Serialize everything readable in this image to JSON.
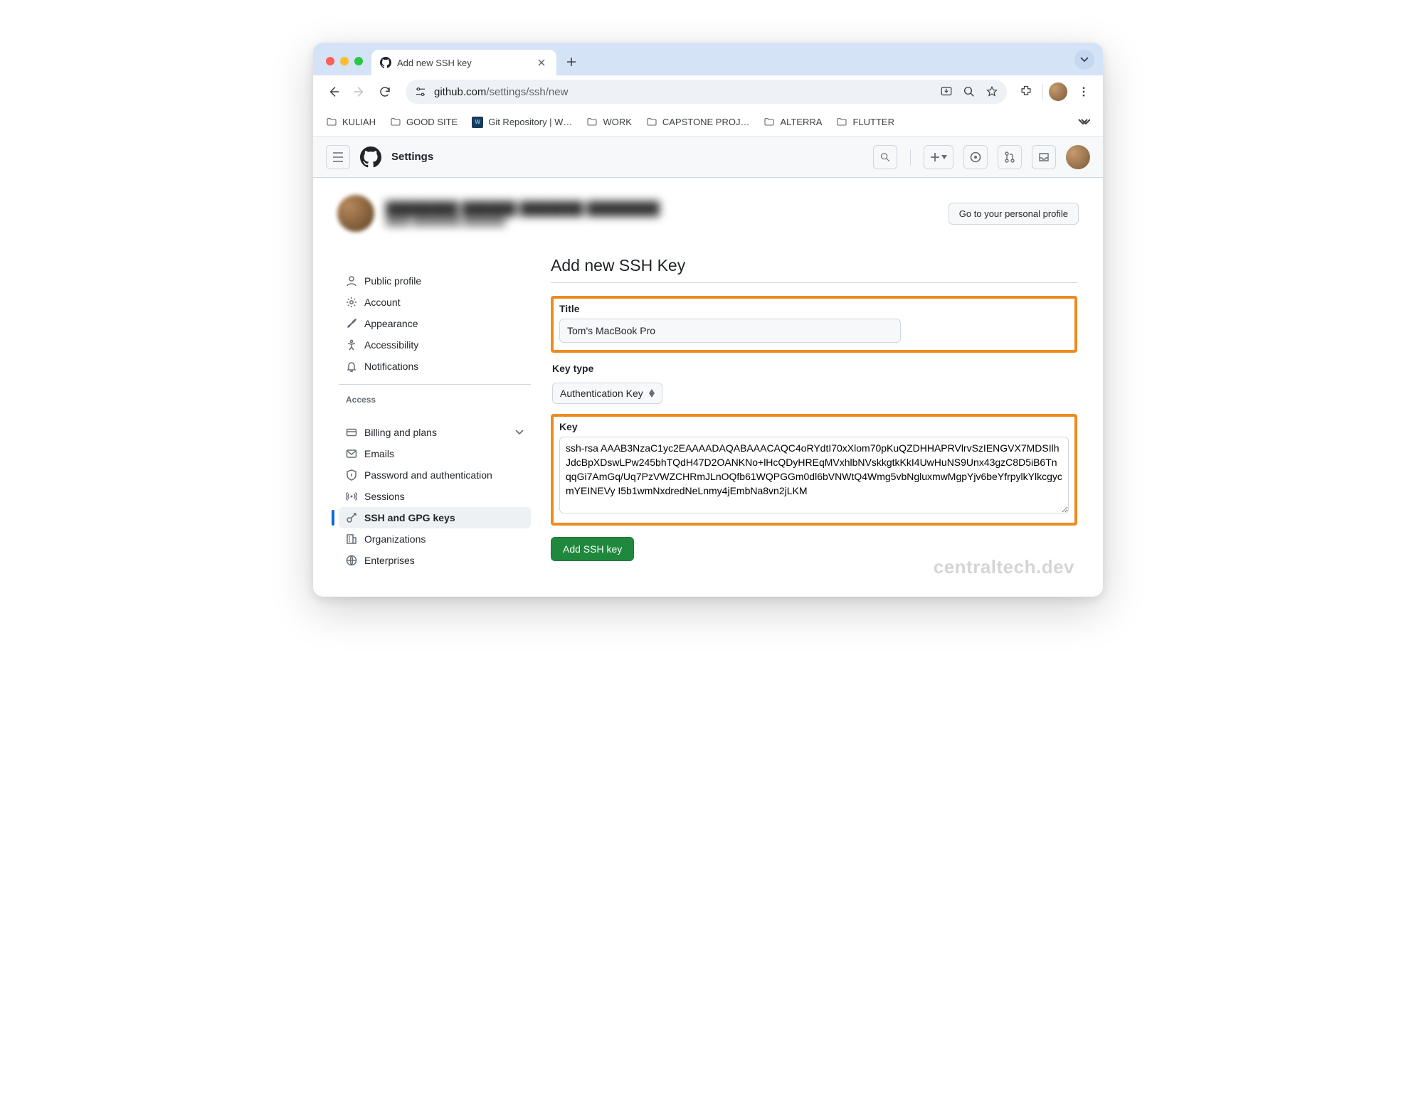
{
  "browser": {
    "tab_title": "Add new SSH key",
    "url_domain": "github.com",
    "url_path": "/settings/ssh/new",
    "bookmarks": [
      {
        "type": "folder",
        "label": "KULIAH"
      },
      {
        "type": "folder",
        "label": "GOOD SITE"
      },
      {
        "type": "site",
        "label": "Git Repository | W…"
      },
      {
        "type": "folder",
        "label": "WORK"
      },
      {
        "type": "folder",
        "label": "CAPSTONE PROJ…"
      },
      {
        "type": "folder",
        "label": "ALTERRA"
      },
      {
        "type": "folder",
        "label": "FLUTTER"
      }
    ]
  },
  "gh_header": {
    "page": "Settings"
  },
  "profile": {
    "go_profile_btn": "Go to your personal profile"
  },
  "sidebar": {
    "items_top": [
      {
        "icon": "person",
        "label": "Public profile"
      },
      {
        "icon": "gear",
        "label": "Account"
      },
      {
        "icon": "brush",
        "label": "Appearance"
      },
      {
        "icon": "accessibility",
        "label": "Accessibility"
      },
      {
        "icon": "bell",
        "label": "Notifications"
      }
    ],
    "access_heading": "Access",
    "items_access": [
      {
        "icon": "card",
        "label": "Billing and plans",
        "expandable": true
      },
      {
        "icon": "mail",
        "label": "Emails"
      },
      {
        "icon": "shield",
        "label": "Password and authentication"
      },
      {
        "icon": "broadcast",
        "label": "Sessions"
      },
      {
        "icon": "key",
        "label": "SSH and GPG keys",
        "active": true
      },
      {
        "icon": "org",
        "label": "Organizations"
      },
      {
        "icon": "globe",
        "label": "Enterprises"
      }
    ]
  },
  "form": {
    "heading": "Add new SSH Key",
    "title_label": "Title",
    "title_value": "Tom's MacBook Pro",
    "keytype_label": "Key type",
    "keytype_value": "Authentication Key",
    "key_label": "Key",
    "key_value": "ssh-rsa AAAB3NzaC1yc2EAAAADAQABAAACAQC4oRYdtI70xXlom70pKuQZDHHAPRVlrvSzIENGVX7MDSIlhJdcBpXDswLPw245bhTQdH47D2OANKNo+lHcQDyHREqMVxhlbNVskkgtkKkI4UwHuNS9Unx43gzC8D5iB6TnqqGi7AmGq/Uq7PzVWZCHRmJLnOQfb61WQPGGm0dl6bVNWtQ4Wmg5vbNgluxmwMgpYjv6beYfrpylkYlkcgycmYEINEVy I5b1wmNxdredNeLnmy4jEmbNa8vn2jLKM",
    "submit_label": "Add SSH key"
  },
  "watermark": "centraltech.dev"
}
